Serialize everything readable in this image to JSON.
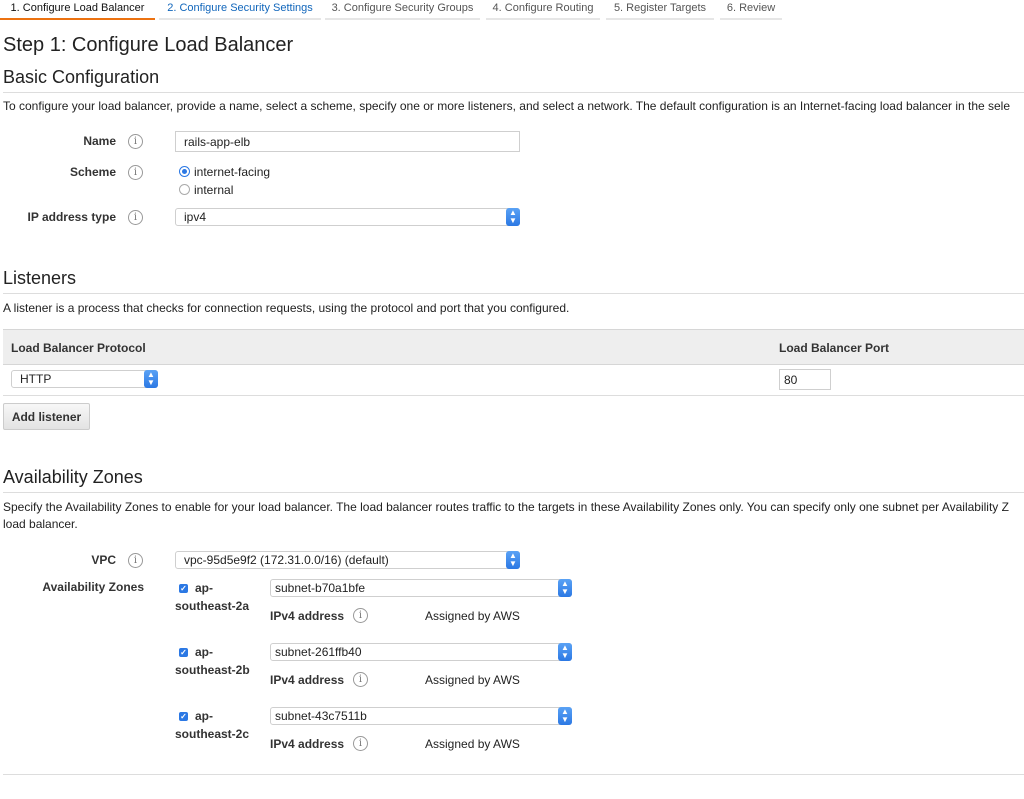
{
  "wizard": {
    "steps": [
      "1. Configure Load Balancer",
      "2. Configure Security Settings",
      "3. Configure Security Groups",
      "4. Configure Routing",
      "5. Register Targets",
      "6. Review"
    ],
    "active_step": 1
  },
  "page_title": "Step 1: Configure Load Balancer",
  "basic": {
    "heading": "Basic Configuration",
    "description": "To configure your load balancer, provide a name, select a scheme, specify one or more listeners, and select a network. The default configuration is an Internet-facing load balancer in the sele",
    "name_label": "Name",
    "name_value": "rails-app-elb",
    "scheme_label": "Scheme",
    "scheme_options": [
      "internet-facing",
      "internal"
    ],
    "scheme_selected": "internet-facing",
    "ip_type_label": "IP address type",
    "ip_type_value": "ipv4",
    "info_glyph": "i"
  },
  "listeners": {
    "heading": "Listeners",
    "description": "A listener is a process that checks for connection requests, using the protocol and port that you configured.",
    "col_protocol": "Load Balancer Protocol",
    "col_port": "Load Balancer Port",
    "protocol_value": "HTTP",
    "port_value": "80",
    "add_button": "Add listener"
  },
  "availability": {
    "heading": "Availability Zones",
    "description_line1": "Specify the Availability Zones to enable for your load balancer. The load balancer routes traffic to the targets in these Availability Zones only. You can specify only one subnet per Availability Z",
    "description_line2": "load balancer.",
    "vpc_label": "VPC",
    "vpc_value": "vpc-95d5e9f2 (172.31.0.0/16) (default)",
    "zones_label": "Availability Zones",
    "ipv4_label": "IPv4 address",
    "assigned_text": "Assigned by AWS",
    "zones": [
      {
        "name_line1": "ap-",
        "name_line2": "southeast-2a",
        "subnet": "subnet-b70a1bfe",
        "checked": true
      },
      {
        "name_line1": "ap-",
        "name_line2": "southeast-2b",
        "subnet": "subnet-261ffb40",
        "checked": true
      },
      {
        "name_line1": "ap-",
        "name_line2": "southeast-2c",
        "subnet": "subnet-43c7511b",
        "checked": true
      }
    ]
  },
  "icons": {
    "info": "info-icon",
    "select_arrows": "chevron-updown-icon",
    "checkbox": "checkmark-icon"
  },
  "colors": {
    "active_tab_underline": "#ec7211",
    "link_blue": "#1166bb",
    "control_blue": "#2b78e4"
  }
}
